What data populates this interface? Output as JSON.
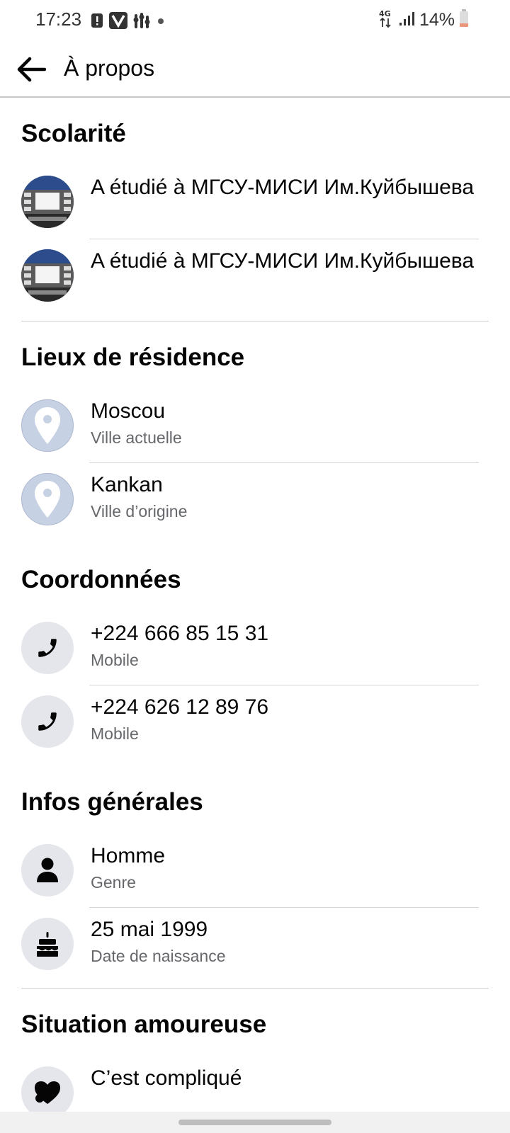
{
  "status_bar": {
    "time": "17:23",
    "battery": "14%",
    "network": "4G"
  },
  "header": {
    "title": "À propos",
    "back_icon": "arrow-left-icon"
  },
  "sections": {
    "education": {
      "title": "Scolarité",
      "items": [
        {
          "text": "A étudié à МГСУ-МИСИ Им.Куйбышева"
        },
        {
          "text": "A étudié à МГСУ-МИСИ Им.Куйбышева"
        }
      ]
    },
    "places": {
      "title": "Lieux de résidence",
      "items": [
        {
          "text": "Moscou",
          "subtext": "Ville actuelle",
          "icon": "map-pin-icon"
        },
        {
          "text": "Kankan",
          "subtext": "Ville d’origine",
          "icon": "map-pin-icon"
        }
      ]
    },
    "contact": {
      "title": "Coordonnées",
      "items": [
        {
          "text": "+224 666 85 15 31",
          "subtext": "Mobile",
          "icon": "phone-icon"
        },
        {
          "text": "+224 626 12 89 76",
          "subtext": "Mobile",
          "icon": "phone-icon"
        }
      ]
    },
    "basic_info": {
      "title": "Infos générales",
      "items": [
        {
          "text": "Homme",
          "subtext": "Genre",
          "icon": "person-icon"
        },
        {
          "text": "25 mai 1999",
          "subtext": "Date de naissance",
          "icon": "birthday-cake-icon"
        }
      ]
    },
    "relationship": {
      "title": "Situation amoureuse",
      "items": [
        {
          "text": "C’est compliqué",
          "icon": "broken-heart-icon"
        }
      ]
    }
  },
  "colors": {
    "text_primary": "#050505",
    "text_secondary": "#65676b",
    "icon_bg": "#e4e6eb",
    "pin_bg": "#c7d1e4"
  }
}
